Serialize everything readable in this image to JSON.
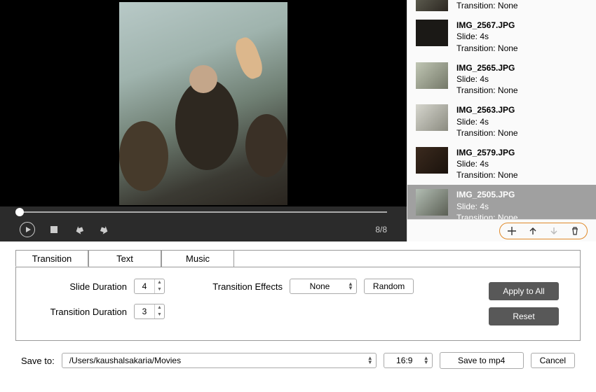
{
  "preview": {
    "counter": "8/8"
  },
  "slides": [
    {
      "name": "",
      "slide": "",
      "transition": "Transition: None"
    },
    {
      "name": "IMG_2567.JPG",
      "slide": "Slide: 4s",
      "transition": "Transition: None"
    },
    {
      "name": "IMG_2565.JPG",
      "slide": "Slide: 4s",
      "transition": "Transition: None"
    },
    {
      "name": "IMG_2563.JPG",
      "slide": "Slide: 4s",
      "transition": "Transition: None"
    },
    {
      "name": "IMG_2579.JPG",
      "slide": "Slide: 4s",
      "transition": "Transition: None"
    },
    {
      "name": "IMG_2505.JPG",
      "slide": "Slide: 4s",
      "transition": "Transition: None"
    }
  ],
  "selected_slide_index": 5,
  "tabs": {
    "transition": "Transition",
    "text": "Text",
    "music": "Music",
    "active": "transition"
  },
  "transition_panel": {
    "slide_duration_label": "Slide Duration",
    "slide_duration_value": "4",
    "transition_duration_label": "Transition Duration",
    "transition_duration_value": "3",
    "transition_effects_label": "Transition Effects",
    "transition_effects_value": "None",
    "random_label": "Random",
    "apply_all_label": "Apply to All",
    "reset_label": "Reset"
  },
  "save": {
    "label": "Save to:",
    "path": "/Users/kaushalsakaria/Movies",
    "aspect": "16:9",
    "save_button": "Save to mp4",
    "cancel_button": "Cancel"
  }
}
